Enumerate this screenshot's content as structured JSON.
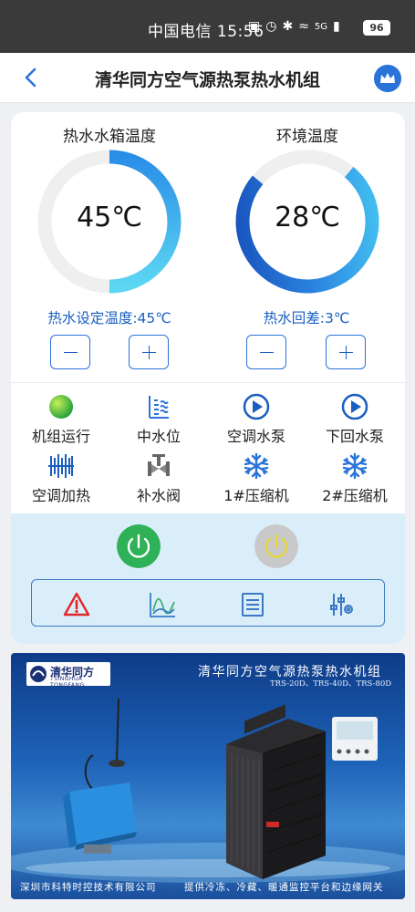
{
  "status_bar": {
    "carrier": "中国电信",
    "time": "15:56",
    "network": "5G",
    "battery": "96"
  },
  "header": {
    "title": "清华同方空气源热泵热水机组"
  },
  "gauges": [
    {
      "title": "热水水箱温度",
      "value": "45℃",
      "fill": 0.5
    },
    {
      "title": "环境温度",
      "value": "28℃",
      "fill": 0.62
    }
  ],
  "settings": [
    {
      "label": "热水设定温度:45℃"
    },
    {
      "label": "热水回差:3℃"
    }
  ],
  "statuses": [
    {
      "label": "机组运行",
      "icon": "green-ball-icon"
    },
    {
      "label": "中水位",
      "icon": "water-level-icon"
    },
    {
      "label": "空调水泵",
      "icon": "pump-play-icon"
    },
    {
      "label": "下回水泵",
      "icon": "pump-play-icon"
    },
    {
      "label": "空调加热",
      "icon": "heating-icon"
    },
    {
      "label": "补水阀",
      "icon": "valve-icon"
    },
    {
      "label": "1#压缩机",
      "icon": "snowflake-icon"
    },
    {
      "label": "2#压缩机",
      "icon": "snowflake-icon"
    }
  ],
  "power": {
    "on_color": "#2fb157",
    "off_color": "#c9c9c9"
  },
  "toolbar": [
    "alarm-icon",
    "chart-icon",
    "list-icon",
    "settings-sliders-icon"
  ],
  "banner": {
    "brand": "清华同方",
    "brand_en": "TSINGHUA TONGFANG",
    "title": "清华同方空气源热泵热水机组",
    "models": "TRS-20D、TRS-40D、TRS-80D",
    "company": "深圳市科特时控技术有限公司",
    "slogan": "提供冷冻、冷藏、暖通监控平台和边缘网关"
  },
  "colors": {
    "accent": "#2a73d9",
    "label_blue": "#1a5fc0"
  }
}
